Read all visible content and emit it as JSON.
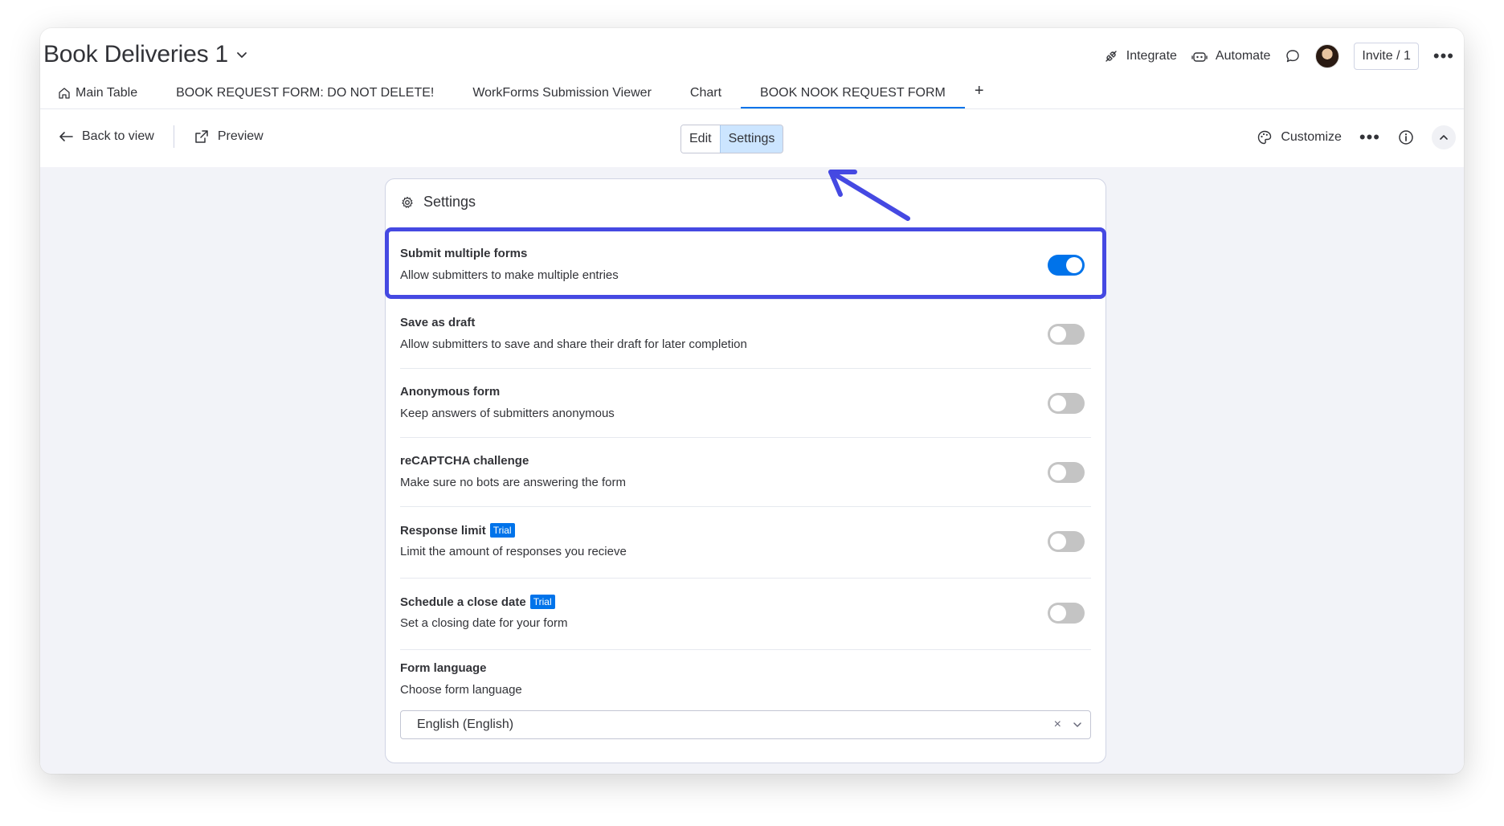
{
  "board": {
    "title": "Book Deliveries 1"
  },
  "top_actions": {
    "integrate": "Integrate",
    "automate": "Automate",
    "invite": "Invite / 1"
  },
  "tabs": [
    {
      "label": "Main Table",
      "active": false
    },
    {
      "label": "BOOK REQUEST FORM: DO NOT DELETE!",
      "active": false
    },
    {
      "label": "WorkForms Submission Viewer",
      "active": false
    },
    {
      "label": "Chart",
      "active": false
    },
    {
      "label": "BOOK NOOK REQUEST FORM",
      "active": true
    }
  ],
  "tab_add_label": "+",
  "toolbar": {
    "back_label": "Back to view",
    "preview_label": "Preview",
    "edit_label": "Edit",
    "settings_label": "Settings",
    "customize_label": "Customize"
  },
  "settings": {
    "title": "Settings",
    "items": [
      {
        "label": "Submit multiple forms",
        "description": "Allow submitters to make multiple entries",
        "enabled": true,
        "trial": ""
      },
      {
        "label": "Save as draft",
        "description": "Allow submitters to save and share their draft for later completion",
        "enabled": false,
        "trial": ""
      },
      {
        "label": "Anonymous form",
        "description": "Keep answers of submitters anonymous",
        "enabled": false,
        "trial": ""
      },
      {
        "label": "reCAPTCHA challenge",
        "description": "Make sure no bots are answering the form",
        "enabled": false,
        "trial": ""
      },
      {
        "label": "Response limit",
        "description": "Limit the amount of responses you recieve",
        "enabled": false,
        "trial": "Trial"
      },
      {
        "label": "Schedule a close date",
        "description": "Set a closing date for your form",
        "enabled": false,
        "trial": "Trial"
      }
    ],
    "language": {
      "label": "Form language",
      "description": "Choose form language",
      "value": "English (English)",
      "clear_symbol": "×"
    }
  },
  "colors": {
    "accent": "#0073ea",
    "highlight": "#4549e2",
    "canvas": "#f2f3f8"
  }
}
